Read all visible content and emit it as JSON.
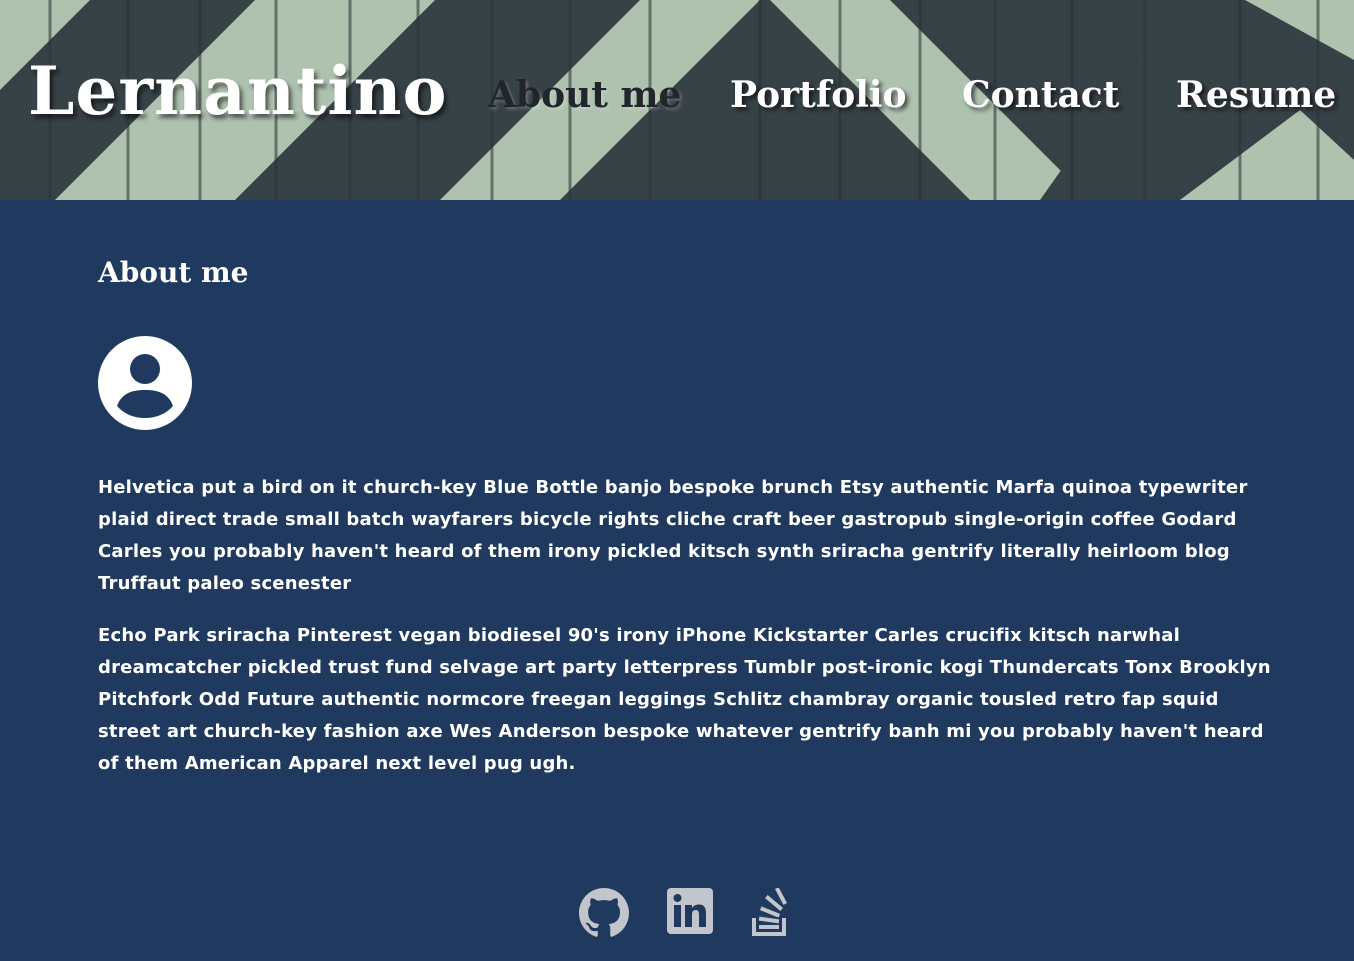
{
  "header": {
    "logo": "Lernantino",
    "nav": [
      {
        "label": "About me",
        "active": true
      },
      {
        "label": "Portfolio",
        "active": false
      },
      {
        "label": "Contact",
        "active": false
      },
      {
        "label": "Resume",
        "active": false
      }
    ]
  },
  "about": {
    "heading": "About me",
    "avatar_icon": "user-circle-icon",
    "paragraphs": [
      "Helvetica put a bird on it church-key Blue Bottle banjo bespoke brunch Etsy authentic Marfa quinoa typewriter plaid direct trade small batch wayfarers bicycle rights cliche craft beer gastropub single-origin coffee Godard Carles you probably haven't heard of them irony pickled kitsch synth sriracha gentrify literally heirloom blog Truffaut paleo scenester",
      "Echo Park sriracha Pinterest vegan biodiesel 90's irony iPhone Kickstarter Carles crucifix kitsch narwhal dreamcatcher pickled trust fund selvage art party letterpress Tumblr post-ironic kogi Thundercats Tonx Brooklyn Pitchfork Odd Future authentic normcore freegan leggings Schlitz chambray organic tousled retro fap squid street art church-key fashion axe Wes Anderson bespoke whatever gentrify banh mi you probably haven't heard of them American Apparel next level pug ugh."
    ]
  },
  "footer": {
    "social_icons": [
      "github-icon",
      "linkedin-icon",
      "stack-overflow-icon"
    ]
  },
  "colors": {
    "background": "#203a5f",
    "text": "#ffffff",
    "active_nav": "#22262c",
    "social_icon": "#c2c6cc",
    "header_stripe": "#b8cdb9"
  }
}
